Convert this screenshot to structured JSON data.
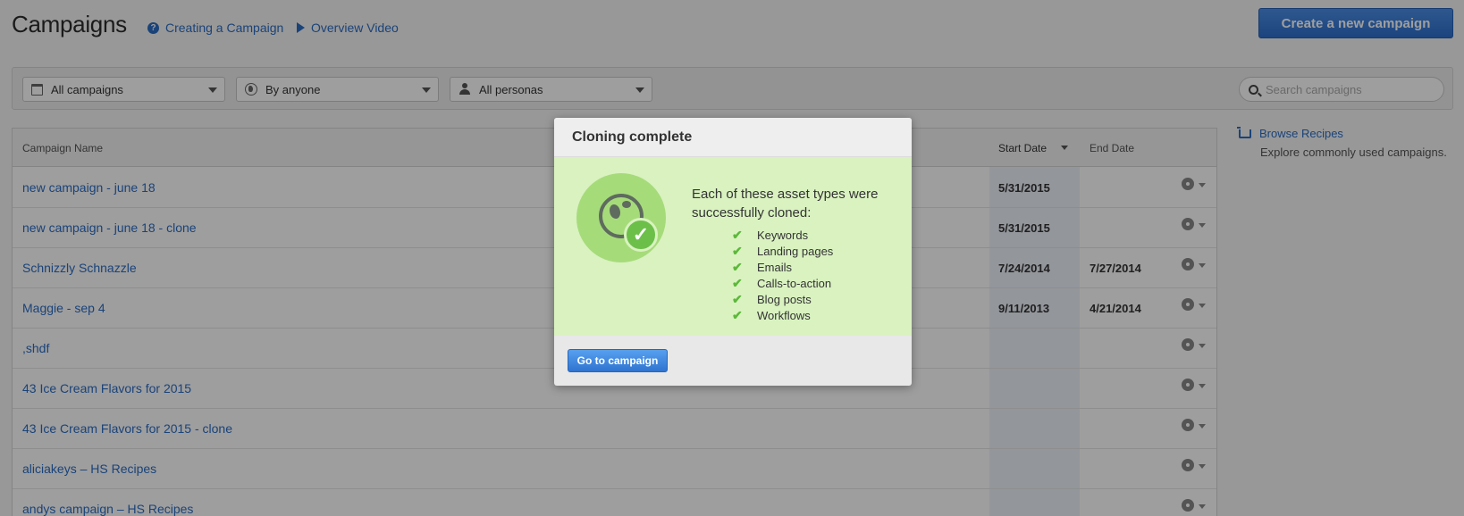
{
  "header": {
    "title": "Campaigns",
    "link_creating": "Creating a Campaign",
    "link_video": "Overview Video",
    "create_button": "Create a new campaign"
  },
  "filters": {
    "campaigns": "All campaigns",
    "owner": "By anyone",
    "personas": "All personas",
    "search_placeholder": "Search campaigns"
  },
  "table": {
    "columns": {
      "name": "Campaign Name",
      "start": "Start Date",
      "end": "End Date"
    },
    "rows": [
      {
        "name": "new campaign - june 18",
        "start": "5/31/2015",
        "end": ""
      },
      {
        "name": "new campaign - june 18 - clone",
        "start": "5/31/2015",
        "end": ""
      },
      {
        "name": "Schnizzly Schnazzle",
        "start": "7/24/2014",
        "end": "7/27/2014"
      },
      {
        "name": "Maggie - sep 4",
        "start": "9/11/2013",
        "end": "4/21/2014"
      },
      {
        "name": ",shdf",
        "start": "",
        "end": ""
      },
      {
        "name": "43 Ice Cream Flavors for 2015",
        "start": "",
        "end": ""
      },
      {
        "name": "43 Ice Cream Flavors for 2015 - clone",
        "start": "",
        "end": ""
      },
      {
        "name": "aliciakeys – HS Recipes",
        "start": "",
        "end": ""
      },
      {
        "name": "andys campaign – HS Recipes",
        "start": "",
        "end": ""
      }
    ]
  },
  "sidebar": {
    "browse_link": "Browse Recipes",
    "browse_desc": "Explore commonly used campaigns."
  },
  "modal": {
    "title": "Cloning complete",
    "message": "Each of these asset types were successfully cloned:",
    "assets": [
      "Keywords",
      "Landing pages",
      "Emails",
      "Calls-to-action",
      "Blog posts",
      "Workflows"
    ],
    "button": "Go to campaign"
  },
  "colors": {
    "link": "#2b6cc4",
    "primary_button": "#2e6fcd",
    "success_bg": "#d9f2c0",
    "success_check": "#5cb83a"
  },
  "icons": {
    "header_help": "question-circle-icon",
    "header_video": "play-icon",
    "filter_campaigns": "calendar-icon",
    "filter_owner": "globe-icon",
    "filter_personas": "person-icon",
    "search": "search-icon",
    "row_actions": "gear-icon",
    "recipes": "cart-icon",
    "modal_hero": "globe-check-icon",
    "asset_item": "checkmark-icon"
  }
}
